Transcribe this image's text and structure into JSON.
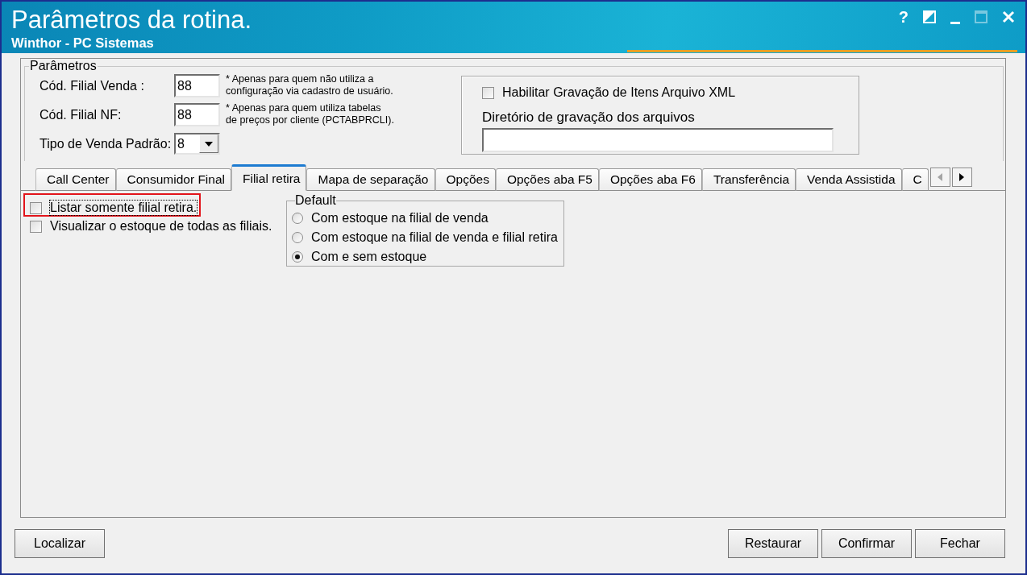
{
  "window": {
    "title": "Parâmetros da rotina.",
    "subtitle": "Winthor - PC Sistemas",
    "controls": [
      {
        "kind": "help",
        "label": "?",
        "disabled": false
      },
      {
        "kind": "contrast",
        "disabled": false
      },
      {
        "kind": "minimize",
        "disabled": false
      },
      {
        "kind": "maximize",
        "disabled": true
      },
      {
        "kind": "close",
        "disabled": false
      }
    ]
  },
  "parametros": {
    "legend": "Parâmetros",
    "fields": [
      {
        "kind": "text",
        "label": "Cód. Filial Venda :",
        "value": "88",
        "note": "* Apenas para quem não utiliza a\nconfiguração via cadastro de usuário."
      },
      {
        "kind": "text",
        "label": "Cód. Filial NF:",
        "value": "88",
        "note": "* Apenas para quem utiliza tabelas\nde preços por cliente (PCTABPRCLI)."
      },
      {
        "kind": "dropdown",
        "label": "Tipo de Venda Padrão:",
        "value": "8"
      }
    ],
    "xml": {
      "checkbox": {
        "label": "Habilitar Gravação de Itens Arquivo XML",
        "checked": false
      },
      "directory_label": "Diretório de gravação dos arquivos"
    }
  },
  "tabs": [
    {
      "label": "Call Center",
      "selected": false
    },
    {
      "label": "Consumidor Final",
      "selected": false
    },
    {
      "label": "Filial retira",
      "selected": true
    },
    {
      "label": "Mapa de separação",
      "selected": false
    },
    {
      "label": "Opções",
      "selected": false
    },
    {
      "label": "Opções aba F5",
      "selected": false
    },
    {
      "label": "Opções aba F6",
      "selected": false
    },
    {
      "label": "Transferência",
      "selected": false
    },
    {
      "label": "Venda Assistida",
      "selected": false
    },
    {
      "label": "C",
      "selected": false
    }
  ],
  "tab_scroll": [
    {
      "kind": "left",
      "disabled": true
    },
    {
      "kind": "right",
      "disabled": false
    }
  ],
  "tab_page": {
    "checkboxes": [
      {
        "label": "Listar somente filial retira.",
        "checked": false,
        "highlighted": true,
        "focused": true
      },
      {
        "label": "Visualizar o estoque de todas as filiais.",
        "checked": false,
        "highlighted": false,
        "focused": false
      }
    ],
    "default_group": {
      "legend": "Default",
      "options": [
        {
          "label": "Com estoque na filial de venda",
          "selected": false
        },
        {
          "label": "Com estoque na filial de venda e filial retira",
          "selected": false
        },
        {
          "label": "Com e sem estoque",
          "selected": true
        }
      ]
    }
  },
  "buttons": {
    "left": [
      "Localizar"
    ],
    "right": [
      "Restaurar",
      "Confirmar",
      "Fechar"
    ]
  }
}
